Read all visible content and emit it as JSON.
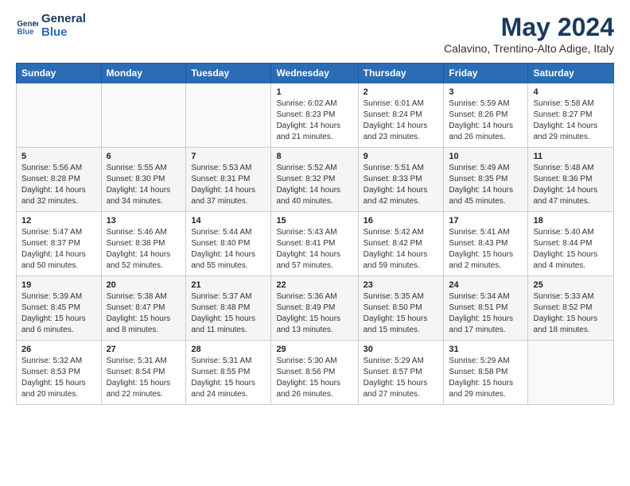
{
  "header": {
    "logo_line1": "General",
    "logo_line2": "Blue",
    "month": "May 2024",
    "location": "Calavino, Trentino-Alto Adige, Italy"
  },
  "weekdays": [
    "Sunday",
    "Monday",
    "Tuesday",
    "Wednesday",
    "Thursday",
    "Friday",
    "Saturday"
  ],
  "weeks": [
    [
      {
        "day": "",
        "content": ""
      },
      {
        "day": "",
        "content": ""
      },
      {
        "day": "",
        "content": ""
      },
      {
        "day": "1",
        "content": "Sunrise: 6:02 AM\nSunset: 8:23 PM\nDaylight: 14 hours\nand 21 minutes."
      },
      {
        "day": "2",
        "content": "Sunrise: 6:01 AM\nSunset: 8:24 PM\nDaylight: 14 hours\nand 23 minutes."
      },
      {
        "day": "3",
        "content": "Sunrise: 5:59 AM\nSunset: 8:26 PM\nDaylight: 14 hours\nand 26 minutes."
      },
      {
        "day": "4",
        "content": "Sunrise: 5:58 AM\nSunset: 8:27 PM\nDaylight: 14 hours\nand 29 minutes."
      }
    ],
    [
      {
        "day": "5",
        "content": "Sunrise: 5:56 AM\nSunset: 8:28 PM\nDaylight: 14 hours\nand 32 minutes."
      },
      {
        "day": "6",
        "content": "Sunrise: 5:55 AM\nSunset: 8:30 PM\nDaylight: 14 hours\nand 34 minutes."
      },
      {
        "day": "7",
        "content": "Sunrise: 5:53 AM\nSunset: 8:31 PM\nDaylight: 14 hours\nand 37 minutes."
      },
      {
        "day": "8",
        "content": "Sunrise: 5:52 AM\nSunset: 8:32 PM\nDaylight: 14 hours\nand 40 minutes."
      },
      {
        "day": "9",
        "content": "Sunrise: 5:51 AM\nSunset: 8:33 PM\nDaylight: 14 hours\nand 42 minutes."
      },
      {
        "day": "10",
        "content": "Sunrise: 5:49 AM\nSunset: 8:35 PM\nDaylight: 14 hours\nand 45 minutes."
      },
      {
        "day": "11",
        "content": "Sunrise: 5:48 AM\nSunset: 8:36 PM\nDaylight: 14 hours\nand 47 minutes."
      }
    ],
    [
      {
        "day": "12",
        "content": "Sunrise: 5:47 AM\nSunset: 8:37 PM\nDaylight: 14 hours\nand 50 minutes."
      },
      {
        "day": "13",
        "content": "Sunrise: 5:46 AM\nSunset: 8:38 PM\nDaylight: 14 hours\nand 52 minutes."
      },
      {
        "day": "14",
        "content": "Sunrise: 5:44 AM\nSunset: 8:40 PM\nDaylight: 14 hours\nand 55 minutes."
      },
      {
        "day": "15",
        "content": "Sunrise: 5:43 AM\nSunset: 8:41 PM\nDaylight: 14 hours\nand 57 minutes."
      },
      {
        "day": "16",
        "content": "Sunrise: 5:42 AM\nSunset: 8:42 PM\nDaylight: 14 hours\nand 59 minutes."
      },
      {
        "day": "17",
        "content": "Sunrise: 5:41 AM\nSunset: 8:43 PM\nDaylight: 15 hours\nand 2 minutes."
      },
      {
        "day": "18",
        "content": "Sunrise: 5:40 AM\nSunset: 8:44 PM\nDaylight: 15 hours\nand 4 minutes."
      }
    ],
    [
      {
        "day": "19",
        "content": "Sunrise: 5:39 AM\nSunset: 8:45 PM\nDaylight: 15 hours\nand 6 minutes."
      },
      {
        "day": "20",
        "content": "Sunrise: 5:38 AM\nSunset: 8:47 PM\nDaylight: 15 hours\nand 8 minutes."
      },
      {
        "day": "21",
        "content": "Sunrise: 5:37 AM\nSunset: 8:48 PM\nDaylight: 15 hours\nand 11 minutes."
      },
      {
        "day": "22",
        "content": "Sunrise: 5:36 AM\nSunset: 8:49 PM\nDaylight: 15 hours\nand 13 minutes."
      },
      {
        "day": "23",
        "content": "Sunrise: 5:35 AM\nSunset: 8:50 PM\nDaylight: 15 hours\nand 15 minutes."
      },
      {
        "day": "24",
        "content": "Sunrise: 5:34 AM\nSunset: 8:51 PM\nDaylight: 15 hours\nand 17 minutes."
      },
      {
        "day": "25",
        "content": "Sunrise: 5:33 AM\nSunset: 8:52 PM\nDaylight: 15 hours\nand 18 minutes."
      }
    ],
    [
      {
        "day": "26",
        "content": "Sunrise: 5:32 AM\nSunset: 8:53 PM\nDaylight: 15 hours\nand 20 minutes."
      },
      {
        "day": "27",
        "content": "Sunrise: 5:31 AM\nSunset: 8:54 PM\nDaylight: 15 hours\nand 22 minutes."
      },
      {
        "day": "28",
        "content": "Sunrise: 5:31 AM\nSunset: 8:55 PM\nDaylight: 15 hours\nand 24 minutes."
      },
      {
        "day": "29",
        "content": "Sunrise: 5:30 AM\nSunset: 8:56 PM\nDaylight: 15 hours\nand 26 minutes."
      },
      {
        "day": "30",
        "content": "Sunrise: 5:29 AM\nSunset: 8:57 PM\nDaylight: 15 hours\nand 27 minutes."
      },
      {
        "day": "31",
        "content": "Sunrise: 5:29 AM\nSunset: 8:58 PM\nDaylight: 15 hours\nand 29 minutes."
      },
      {
        "day": "",
        "content": ""
      }
    ]
  ]
}
